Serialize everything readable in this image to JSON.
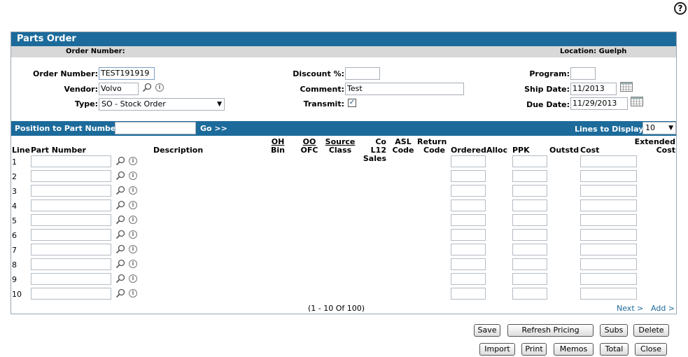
{
  "help": {
    "label": "?"
  },
  "panel": {
    "title": "Parts Order",
    "subheader": {
      "order_number_label": "Order Number:",
      "location_label": "Location:",
      "location_value": "Guelph"
    }
  },
  "form": {
    "order_number": {
      "label": "Order Number:",
      "value": "TEST191919"
    },
    "vendor": {
      "label": "Vendor:",
      "value": "Volvo"
    },
    "type": {
      "label": "Type:",
      "value": "SO - Stock Order"
    },
    "discount": {
      "label": "Discount %:",
      "value": ""
    },
    "comment": {
      "label": "Comment:",
      "value": "Test"
    },
    "transmit": {
      "label": "Transmit:",
      "checked": true
    },
    "program": {
      "label": "Program:",
      "value": ""
    },
    "ship_date": {
      "label": "Ship Date:",
      "value": "11/2013"
    },
    "due_date": {
      "label": "Due Date:",
      "value": "11/29/2013"
    }
  },
  "navbar": {
    "position_label": "Position to Part Number:",
    "position_value": "",
    "go_label": "Go >>",
    "lines_label": "Lines to Display:",
    "lines_value": "10"
  },
  "table": {
    "headers": {
      "line": "Line",
      "part_number": "Part Number",
      "description": "Description",
      "oh": "OH",
      "bin": "Bin",
      "oo": "OO",
      "ofc": "OFC",
      "source": "Source",
      "class": "Class",
      "col12": "Co L12",
      "sales": "Sales",
      "asl": "ASL",
      "code": "Code",
      "return": "Return",
      "return_code": "Code",
      "ordered": "Ordered",
      "alloc": "Alloc",
      "ppk": "PPK",
      "outstd": "Outstd",
      "cost": "Cost",
      "extended": "Extended",
      "extended_cost": "Cost"
    },
    "rows": [
      {
        "line": "1"
      },
      {
        "line": "2"
      },
      {
        "line": "3"
      },
      {
        "line": "4"
      },
      {
        "line": "5"
      },
      {
        "line": "6"
      },
      {
        "line": "7"
      },
      {
        "line": "8"
      },
      {
        "line": "9"
      },
      {
        "line": "10"
      }
    ]
  },
  "pager": {
    "range": "(1  -  10  Of  100)",
    "next": "Next >",
    "add": "Add >"
  },
  "buttons": {
    "save": "Save",
    "refresh_pricing": "Refresh Pricing",
    "subs": "Subs",
    "delete": "Delete",
    "import": "Import",
    "print": "Print",
    "memos": "Memos",
    "total": "Total",
    "close": "Close"
  },
  "icons": {
    "lookup": "magnifier-icon",
    "info": "info-icon",
    "calendar": "calendar-icon"
  },
  "colors": {
    "header_blue": "#1c6b9b",
    "subheader_gray": "#d8d8d8"
  }
}
